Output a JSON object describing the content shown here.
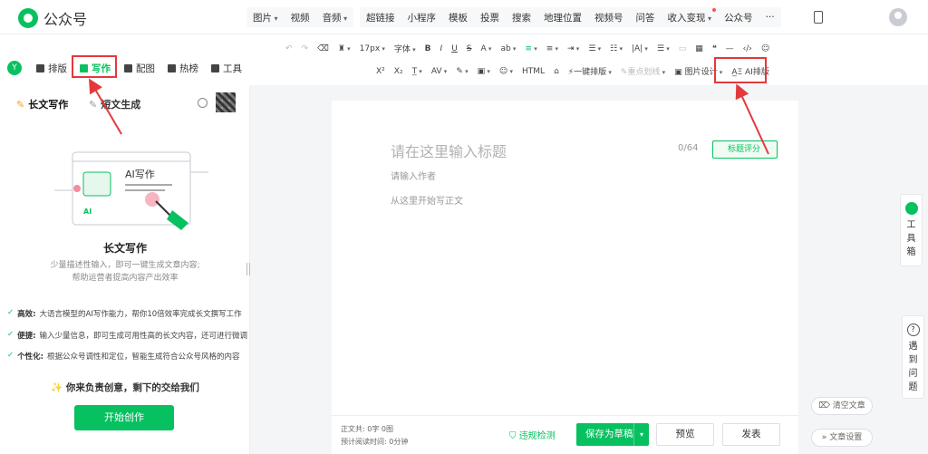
{
  "app": {
    "title": "公众号"
  },
  "topnav": {
    "group1": [
      "图片",
      "视频",
      "音频"
    ],
    "group2": [
      "超链接",
      "小程序",
      "模板",
      "投票",
      "搜索",
      "地理位置",
      "视频号",
      "问答",
      "收入变现",
      "公众号",
      "···"
    ]
  },
  "toolbar": {
    "row1": {
      "font_size": "17px",
      "font": "字体"
    },
    "row2": {
      "one_click": "一键排版",
      "key_line": "重点划线",
      "img_design": "图片设计",
      "ai_layout": "AI排版"
    }
  },
  "sidebar": {
    "tabs": [
      "排版",
      "写作",
      "配图",
      "热榜",
      "工具"
    ],
    "sub_tabs": [
      "长文写作",
      "短文生成"
    ],
    "illus_label": "AI写作",
    "section_title": "长文写作",
    "section_desc": [
      "少量描述性输入，即可一键生成文章内容;",
      "帮助运营者提高内容产出效率"
    ],
    "features": [
      {
        "k": "高效:",
        "v": "大语言模型的AI写作能力，帮你10倍效率完成长文撰写工作"
      },
      {
        "k": "便捷:",
        "v": "输入少量信息，即可生成可用性高的长文内容，还可进行微调"
      },
      {
        "k": "个性化:",
        "v": "根据公众号调性和定位，智能生成符合公众号风格的内容"
      }
    ],
    "slogan": "✨ 你来负责创意，剩下的交给我们",
    "start": "开始创作"
  },
  "editor": {
    "title_placeholder": "请在这里输入标题",
    "count": "0/64",
    "score": "标题评分",
    "author_placeholder": "请输入作者",
    "body_placeholder": "从这里开始写正文"
  },
  "bottom": {
    "stat1": "正文共: 0字 0图",
    "stat2": "预计阅读时间: 0分钟",
    "check": "违规检测",
    "save": "保存为草稿",
    "preview": "预览",
    "publish": "发表"
  },
  "right": {
    "toolbox": [
      "工",
      "具",
      "箱"
    ],
    "help": [
      "遇",
      "到",
      "问",
      "题"
    ],
    "clear": "清空文章",
    "settings": "文章设置"
  },
  "colors": {
    "accent": "#07c160",
    "highlight": "#e4393c"
  }
}
